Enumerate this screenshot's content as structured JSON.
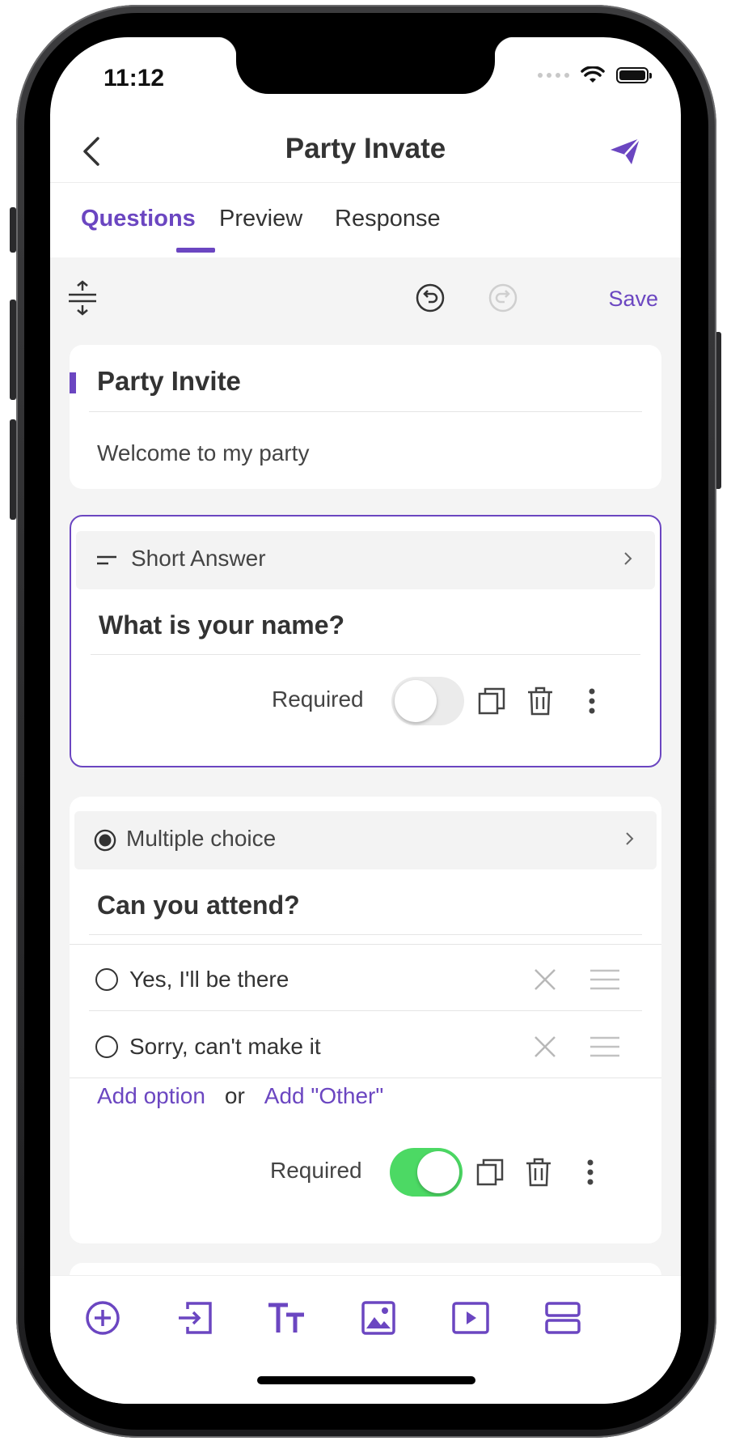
{
  "status_bar": {
    "time": "11:12"
  },
  "header": {
    "title": "Party Invate"
  },
  "tabs": [
    {
      "label": "Questions",
      "active": true
    },
    {
      "label": "Preview",
      "active": false
    },
    {
      "label": "Response",
      "active": false
    }
  ],
  "toolbar": {
    "save_label": "Save"
  },
  "form": {
    "title": "Party Invite",
    "description": "Welcome to my party"
  },
  "questions": [
    {
      "type_label": "Short Answer",
      "text": "What is your name?",
      "required_label": "Required",
      "required": false
    },
    {
      "type_label": "Multiple choice",
      "text": "Can you attend?",
      "options": [
        "Yes,  I'll be there",
        "Sorry, can't make it"
      ],
      "add_option_label": "Add option",
      "or_label": "or",
      "add_other_label": "Add \"Other\"",
      "required_label": "Required",
      "required": true
    }
  ],
  "bottom_bar": {
    "icons": [
      "add-question-icon",
      "import-question-icon",
      "add-title-text-icon",
      "add-image-icon",
      "add-video-icon",
      "add-section-icon"
    ]
  },
  "colors": {
    "accent": "#6b46c1",
    "toggle_on": "#4cd964",
    "background": "#f4f4f4"
  }
}
